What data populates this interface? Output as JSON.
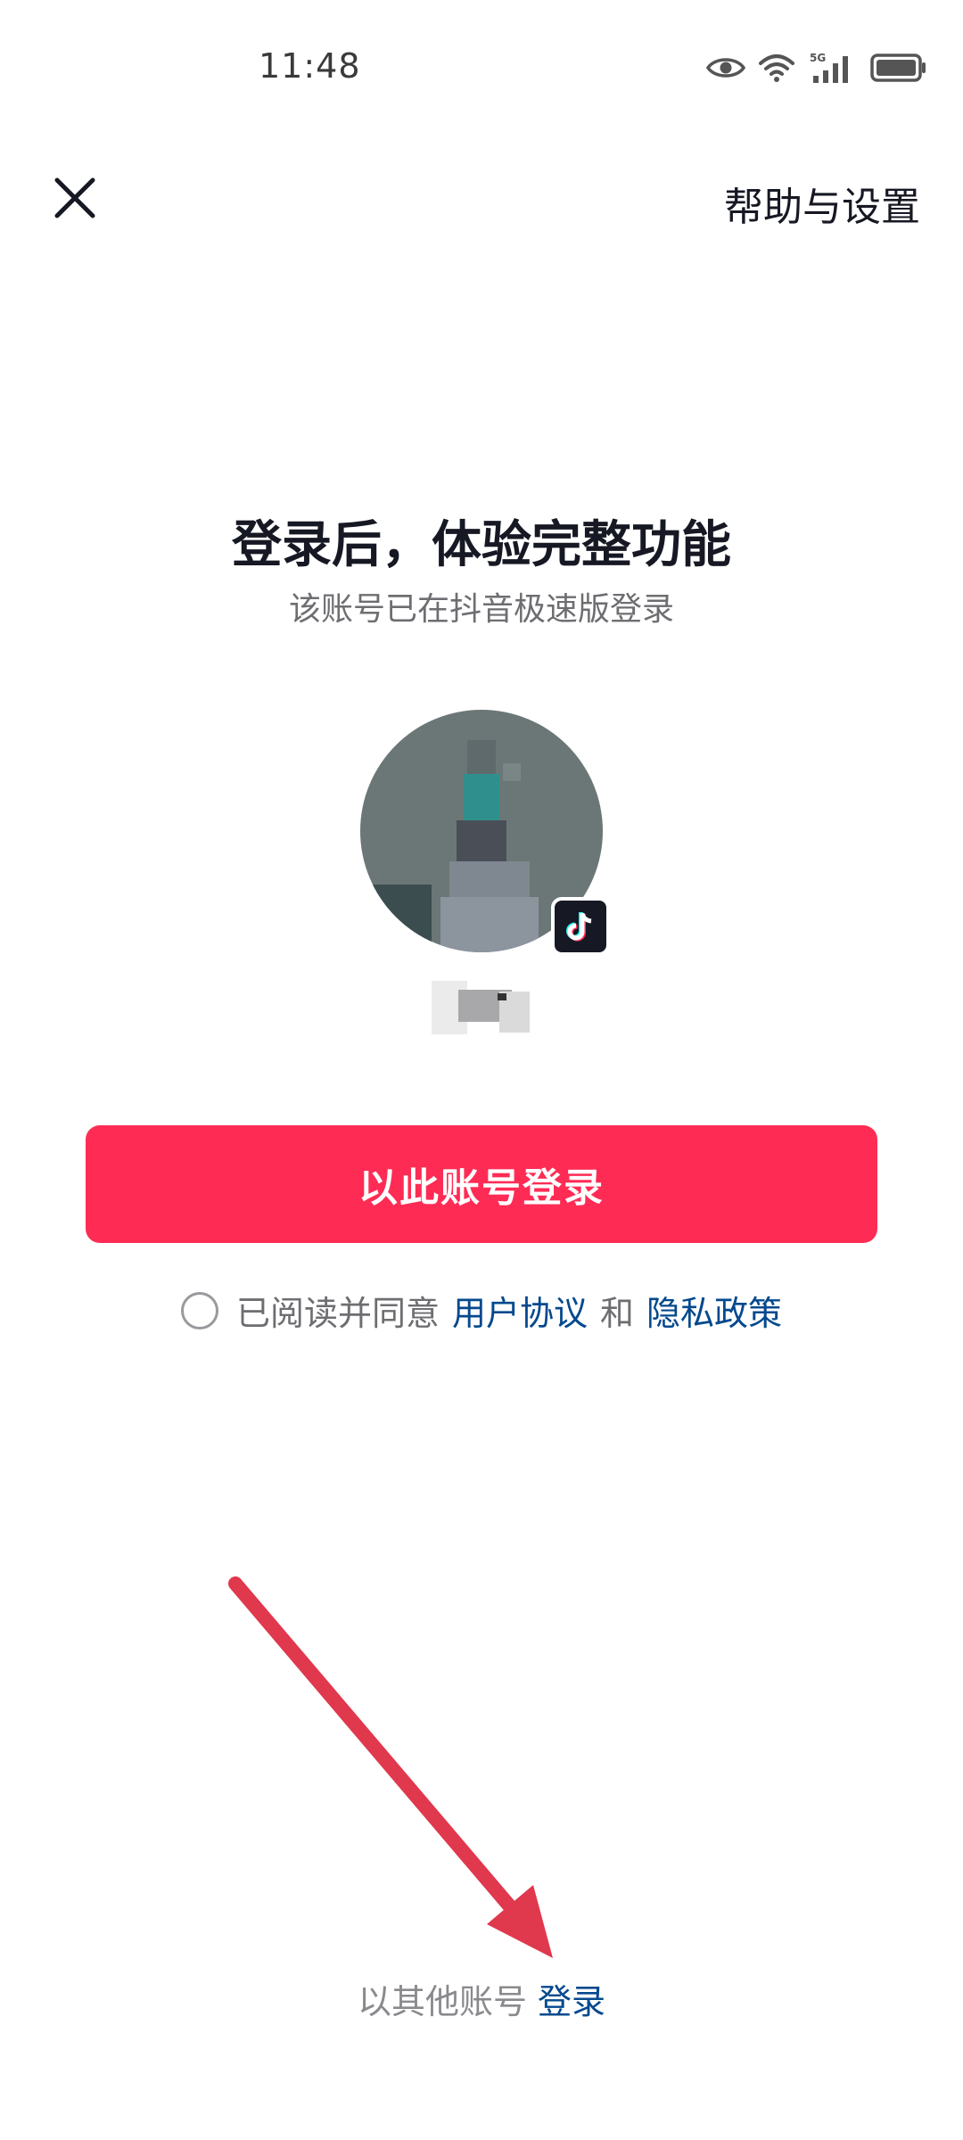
{
  "status_bar": {
    "time": "11:48",
    "icons": [
      "eye-icon",
      "wifi-icon",
      "5g-signal-icon",
      "battery-icon"
    ],
    "network_label": "5G"
  },
  "top_bar": {
    "close_icon": "close-icon",
    "help_label": "帮助与设置"
  },
  "main": {
    "title": "登录后，体验完整功能",
    "subtitle": "该账号已在抖音极速版登录",
    "login_button_label": "以此账号登录"
  },
  "agreement": {
    "prefix": "已阅读并同意",
    "user_agreement": "用户协议",
    "and": "和",
    "privacy_policy": "隐私政策",
    "checked": false
  },
  "bottom": {
    "other_account_text": "以其他账号",
    "login_link": "登录"
  },
  "colors": {
    "accent": "#fe2c55",
    "link": "#04498d",
    "annotation_arrow": "#e0384d"
  }
}
